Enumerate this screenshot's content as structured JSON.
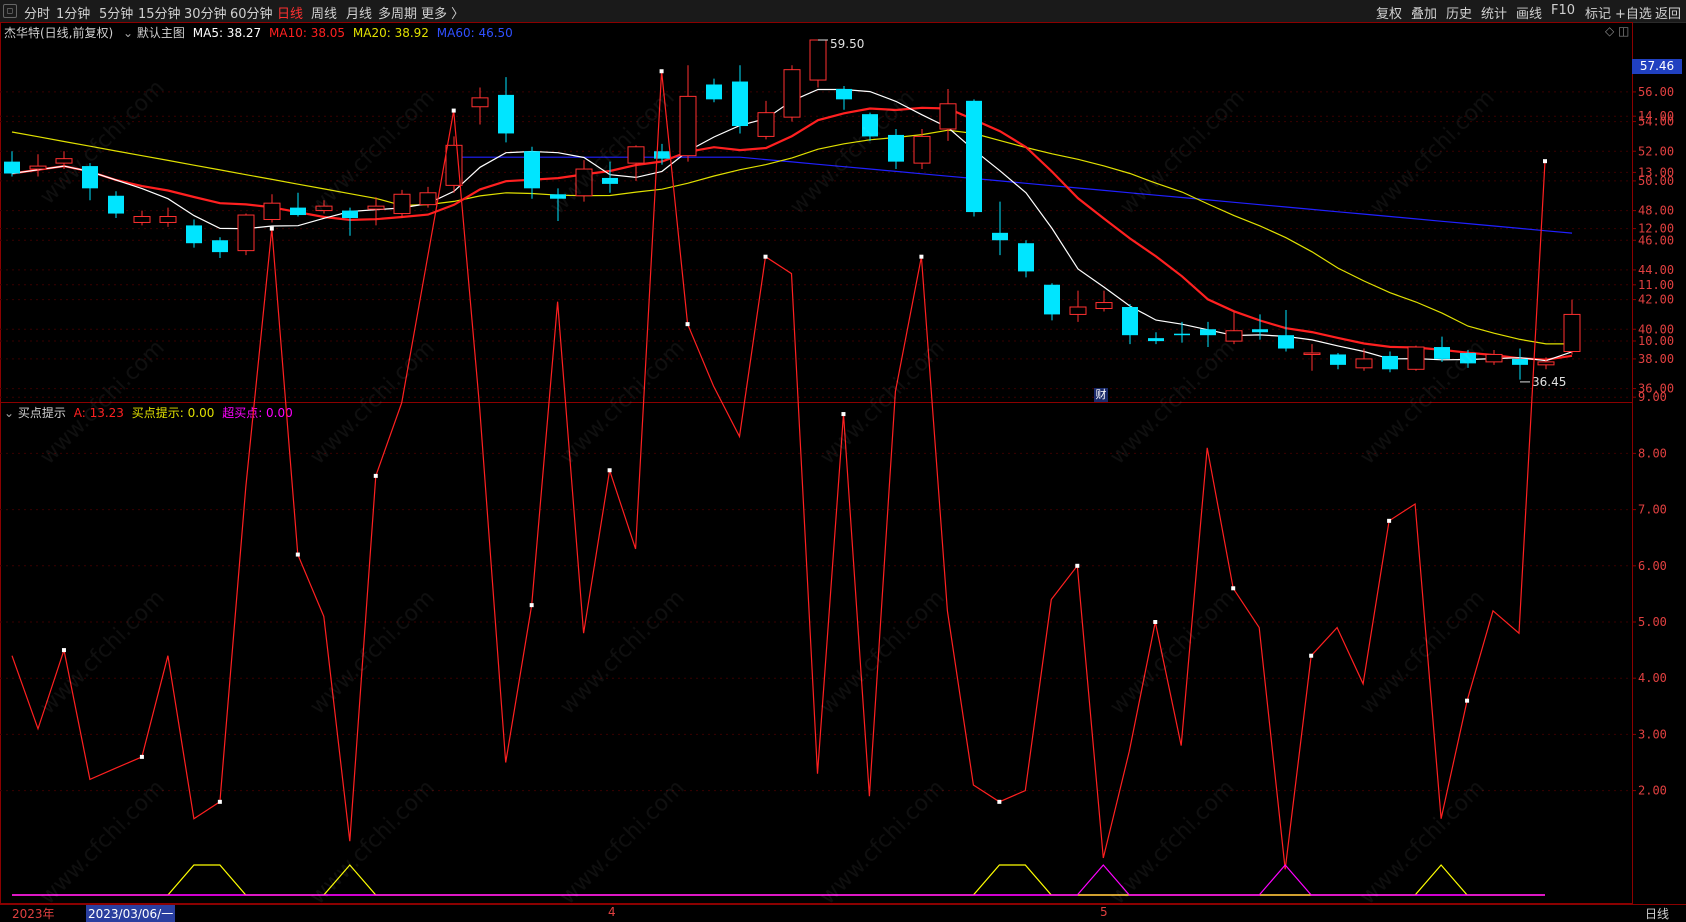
{
  "toolbar": {
    "periods": [
      "分时",
      "1分钟",
      "5分钟",
      "15分钟",
      "30分钟",
      "60分钟",
      "日线",
      "周线",
      "月线",
      "多周期",
      "更多 〉"
    ],
    "active_period": "日线",
    "right_items": [
      "复权",
      "叠加",
      "历史",
      "统计",
      "画线",
      "F10",
      "标记",
      "+自选",
      "返回"
    ]
  },
  "main_chart": {
    "stock_title": "杰华特(日线,前复权)",
    "template_label": "默认主图",
    "ma5": "MA5: 38.27",
    "ma10": "MA10: 38.05",
    "ma20": "MA20: 38.92",
    "ma60": "MA60: 46.50",
    "current_price": "57.46",
    "high_marker": "59.50",
    "low_marker": "36.45",
    "finance_badge": "财",
    "y_ticks": [
      "56.00",
      "54.00",
      "52.00",
      "50.00",
      "48.00",
      "46.00",
      "44.00",
      "42.00",
      "40.00",
      "38.00",
      "36.00"
    ]
  },
  "indicator": {
    "name": "买点提示",
    "a_value": "A: 13.23",
    "buy_hint": "买点提示: 0.00",
    "super_buy": "超买点: 0.00",
    "y_ticks": [
      "14.00",
      "13.00",
      "12.00",
      "11.00",
      "10.00",
      "9.00",
      "8.00",
      "7.00",
      "6.00",
      "5.00",
      "4.00",
      "3.00",
      "2.00"
    ]
  },
  "footer": {
    "year_label": "2023年",
    "cursor_date": "2023/03/06/一",
    "month_4": "4",
    "month_5": "5",
    "period_label": "日线"
  },
  "watermark": "www.cfchi.com",
  "colors": {
    "up": "#ff3030",
    "down": "#00e5ff",
    "ma5": "#ffffff",
    "ma10": "#ff2020",
    "ma20": "#e0e000",
    "ma60": "#2020ff",
    "indicator_a": "#ff2020",
    "buy": "#ffff00",
    "super": "#ff00ff"
  },
  "chart_data": [
    {
      "type": "candlestick",
      "title": "杰华特(日线,前复权)",
      "ylim": [
        35,
        59.5
      ],
      "candles": [
        [
          51.3,
          50.5,
          52.0,
          50.3
        ],
        [
          50.8,
          51.0,
          51.8,
          50.3
        ],
        [
          51.2,
          51.5,
          52.0,
          50.8
        ],
        [
          51.0,
          49.5,
          51.2,
          48.7
        ],
        [
          49.0,
          47.8,
          49.3,
          47.5
        ],
        [
          47.2,
          47.6,
          48.0,
          47.0
        ],
        [
          47.2,
          47.6,
          48.2,
          46.9
        ],
        [
          47.0,
          45.8,
          47.4,
          45.5
        ],
        [
          46.0,
          45.2,
          46.2,
          44.8
        ],
        [
          45.3,
          47.7,
          47.8,
          45.0
        ],
        [
          47.4,
          48.5,
          49.1,
          47.2
        ],
        [
          48.2,
          47.7,
          49.2,
          47.6
        ],
        [
          48.0,
          48.3,
          48.7,
          47.8
        ],
        [
          48.0,
          47.5,
          48.2,
          46.3
        ],
        [
          48.1,
          48.3,
          48.9,
          47.0
        ],
        [
          47.8,
          49.1,
          49.4,
          47.5
        ],
        [
          48.4,
          49.2,
          49.6,
          48.2
        ],
        [
          49.7,
          52.4,
          53.0,
          49.2
        ],
        [
          55.0,
          55.6,
          56.3,
          53.8
        ],
        [
          55.8,
          53.2,
          57.0,
          52.6
        ],
        [
          52.0,
          49.5,
          52.3,
          48.8
        ],
        [
          49.1,
          48.8,
          49.5,
          47.3
        ],
        [
          49.0,
          50.8,
          51.4,
          48.6
        ],
        [
          50.2,
          49.8,
          51.3,
          49.2
        ],
        [
          51.2,
          52.3,
          52.4,
          50.0
        ],
        [
          52.0,
          51.5,
          52.5,
          51.1
        ],
        [
          51.7,
          55.7,
          57.8,
          51.3
        ],
        [
          56.5,
          55.5,
          56.9,
          55.3
        ],
        [
          56.7,
          53.7,
          57.8,
          53.2
        ],
        [
          53.0,
          54.6,
          55.4,
          52.8
        ],
        [
          54.3,
          57.5,
          57.8,
          54.0
        ],
        [
          56.8,
          59.5,
          59.5,
          56.3
        ],
        [
          56.2,
          55.5,
          56.4,
          54.8
        ],
        [
          54.5,
          53.0,
          54.6,
          52.7
        ],
        [
          53.1,
          51.3,
          53.5,
          50.8
        ],
        [
          51.2,
          53.0,
          53.5,
          50.8
        ],
        [
          53.5,
          55.2,
          56.2,
          52.7
        ],
        [
          55.4,
          47.9,
          55.5,
          47.6
        ],
        [
          46.5,
          46.0,
          48.6,
          45.0
        ],
        [
          45.8,
          43.9,
          46.0,
          43.5
        ],
        [
          43.0,
          41.0,
          43.1,
          40.6
        ],
        [
          41.0,
          41.5,
          42.6,
          40.5
        ],
        [
          41.4,
          41.8,
          42.6,
          41.2
        ],
        [
          41.5,
          39.6,
          41.7,
          39.0
        ],
        [
          39.4,
          39.2,
          39.8,
          39.0
        ],
        [
          39.7,
          39.6,
          40.5,
          39.1
        ],
        [
          40.0,
          39.6,
          40.5,
          38.8
        ],
        [
          39.2,
          39.9,
          41.2,
          39.0
        ],
        [
          40.0,
          39.8,
          41.0,
          39.3
        ],
        [
          39.6,
          38.7,
          41.3,
          38.5
        ],
        [
          38.4,
          38.4,
          39.0,
          37.2
        ],
        [
          38.3,
          37.6,
          38.4,
          37.3
        ],
        [
          37.4,
          38.0,
          38.7,
          37.2
        ],
        [
          38.2,
          37.3,
          38.5,
          37.1
        ],
        [
          37.3,
          38.8,
          38.9,
          37.2
        ],
        [
          38.8,
          38.0,
          39.5,
          37.8
        ],
        [
          38.4,
          37.7,
          38.6,
          37.4
        ],
        [
          37.8,
          38.3,
          38.6,
          37.6
        ],
        [
          38.0,
          37.6,
          38.7,
          36.6
        ],
        [
          37.6,
          37.8,
          38.1,
          37.3
        ],
        [
          38.5,
          41.0,
          42.0,
          38.3
        ]
      ]
    },
    {
      "type": "line",
      "title": "买点提示",
      "ylim": [
        0,
        15
      ],
      "series": [
        {
          "name": "A",
          "values": [
            4.4,
            3.1,
            4.5,
            2.2,
            2.4,
            2.6,
            4.4,
            1.5,
            1.8,
            7.4,
            12.0,
            6.2,
            5.1,
            1.1,
            7.6,
            8.9,
            11.5,
            14.1,
            8.8,
            2.5,
            5.3,
            10.7,
            4.8,
            7.7,
            6.3,
            14.8,
            10.3,
            9.2,
            8.3,
            11.5,
            11.2,
            2.3,
            8.7,
            1.9,
            9.1,
            11.5,
            5.2,
            2.1,
            1.8,
            2.0,
            5.4,
            6.0,
            0.8,
            2.7,
            5.0,
            2.8,
            8.1,
            5.6,
            4.9,
            0.6,
            4.4,
            4.9,
            3.9,
            6.8,
            7.1,
            1.5,
            3.6,
            5.2,
            4.8,
            13.2
          ]
        },
        {
          "name": "买点提示",
          "values": [
            0,
            0,
            0,
            0,
            0,
            0,
            0,
            1,
            1,
            0,
            0,
            0,
            0,
            1,
            0,
            0,
            0,
            0,
            0,
            0,
            0,
            0,
            0,
            0,
            0,
            0,
            0,
            0,
            0,
            0,
            0,
            0,
            0,
            0,
            0,
            0,
            0,
            0,
            1,
            1,
            0,
            0,
            0,
            0,
            0,
            0,
            0,
            0,
            0,
            0,
            0,
            0,
            0,
            0,
            0,
            1,
            0,
            0,
            0,
            0
          ]
        },
        {
          "name": "超买点",
          "values": [
            0,
            0,
            0,
            0,
            0,
            0,
            0,
            0,
            0,
            0,
            0,
            0,
            0,
            0,
            0,
            0,
            0,
            0,
            0,
            0,
            0,
            0,
            0,
            0,
            0,
            0,
            0,
            0,
            0,
            0,
            0,
            0,
            0,
            0,
            0,
            0,
            0,
            0,
            0,
            0,
            0,
            0,
            1,
            0,
            0,
            0,
            0,
            0,
            0,
            1,
            0,
            0,
            0,
            0,
            0,
            0,
            0,
            0,
            0,
            0
          ]
        }
      ]
    }
  ]
}
